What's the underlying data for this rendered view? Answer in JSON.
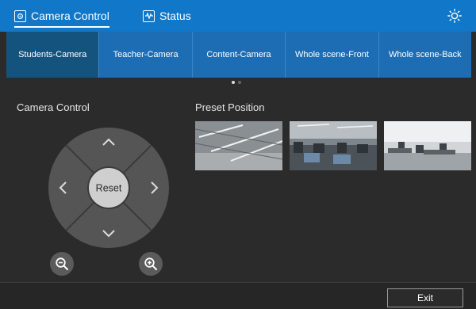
{
  "tabs": {
    "camera_control": "Camera Control",
    "status": "Status"
  },
  "cameras": [
    {
      "label": "Students-Camera",
      "active": true
    },
    {
      "label": "Teacher-Camera",
      "active": false
    },
    {
      "label": "Content-Camera",
      "active": false
    },
    {
      "label": "Whole scene-Front",
      "active": false
    },
    {
      "label": "Whole scene-Back",
      "active": false
    }
  ],
  "page_indicator": {
    "pages": 2,
    "current": 1
  },
  "camera_control": {
    "title": "Camera Control",
    "reset_label": "Reset"
  },
  "preset": {
    "title": "Preset Position"
  },
  "footer": {
    "exit_label": "Exit"
  },
  "colors": {
    "accent": "#1177c9",
    "active_camera": "#15537f",
    "background": "#2b2b2b"
  },
  "icons": [
    "camera-control-icon",
    "status-icon",
    "brightness-icon",
    "zoom-out-icon",
    "zoom-in-icon"
  ]
}
